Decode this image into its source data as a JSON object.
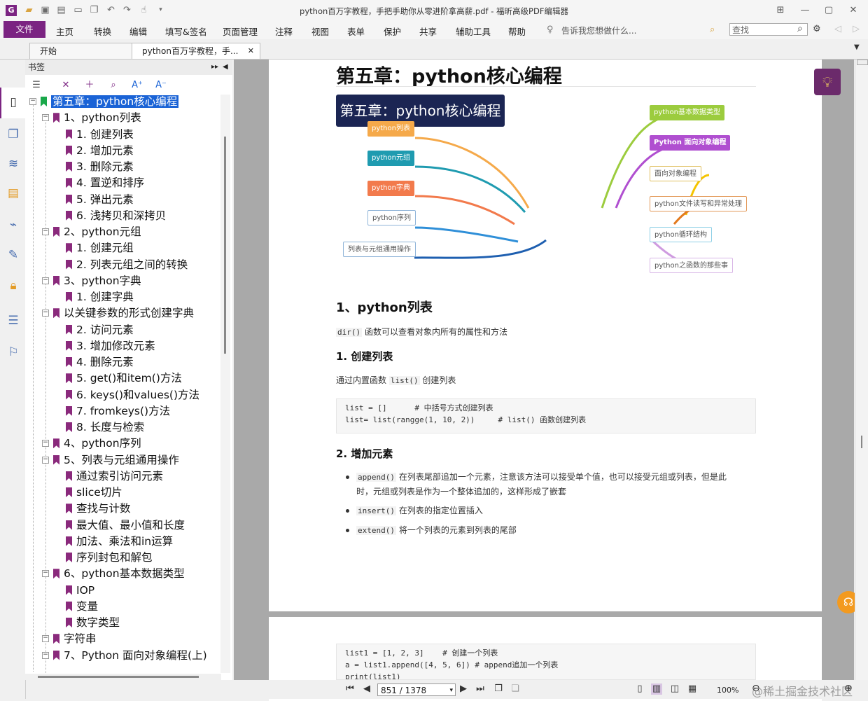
{
  "window": {
    "title": "python百万字教程，手把手助你从零进阶拿高薪.pdf - 福昕高级PDF编辑器"
  },
  "menu": {
    "file": "文件",
    "items": [
      "主页",
      "转换",
      "编辑",
      "填写&签名",
      "页面管理",
      "注释",
      "视图",
      "表单",
      "保护",
      "共享",
      "辅助工具",
      "帮助"
    ],
    "tell_me": "告诉我您想做什么...",
    "search_placeholder": "查找"
  },
  "tabs": [
    {
      "label": "开始"
    },
    {
      "label": "python百万字教程，手..."
    }
  ],
  "bookmarks": {
    "header": "书签",
    "items": [
      {
        "label": "第五章：python核心编程",
        "level": 0,
        "selected": true
      },
      {
        "label": "1、python列表",
        "level": 1
      },
      {
        "label": "1. 创建列表",
        "level": 2
      },
      {
        "label": "2. 增加元素",
        "level": 2
      },
      {
        "label": "3. 删除元素",
        "level": 2
      },
      {
        "label": "4. 置逆和排序",
        "level": 2
      },
      {
        "label": "5. 弹出元素",
        "level": 2
      },
      {
        "label": "6. 浅拷贝和深拷贝",
        "level": 2
      },
      {
        "label": "2、python元组",
        "level": 1
      },
      {
        "label": "1. 创建元组",
        "level": 2
      },
      {
        "label": "2. 列表元组之间的转换",
        "level": 2
      },
      {
        "label": "3、python字典",
        "level": 1
      },
      {
        "label": "1. 创建字典",
        "level": 2
      },
      {
        "label": "以关键参数的形式创建字典",
        "level": 1
      },
      {
        "label": "2. 访问元素",
        "level": 2
      },
      {
        "label": "3. 增加修改元素",
        "level": 2
      },
      {
        "label": "4. 删除元素",
        "level": 2
      },
      {
        "label": "5. get()和item()方法",
        "level": 2
      },
      {
        "label": "6. keys()和values()方法",
        "level": 2
      },
      {
        "label": "7. fromkeys()方法",
        "level": 2
      },
      {
        "label": "8. 长度与检索",
        "level": 2
      },
      {
        "label": "4、python序列",
        "level": 1
      },
      {
        "label": "5、列表与元组通用操作",
        "level": 1
      },
      {
        "label": "通过索引访问元素",
        "level": 2
      },
      {
        "label": "slice切片",
        "level": 2
      },
      {
        "label": "查找与计数",
        "level": 2
      },
      {
        "label": "最大值、最小值和长度",
        "level": 2
      },
      {
        "label": "加法、乘法和in运算",
        "level": 2
      },
      {
        "label": "序列封包和解包",
        "level": 2
      },
      {
        "label": "6、python基本数据类型",
        "level": 1
      },
      {
        "label": "IOP",
        "level": 2
      },
      {
        "label": "变量",
        "level": 2
      },
      {
        "label": "数字类型",
        "level": 2
      },
      {
        "label": "字符串",
        "level": 1
      },
      {
        "label": "7、Python 面向对象编程(上)",
        "level": 1
      }
    ]
  },
  "page": {
    "chapter_title": "第五章：python核心编程",
    "mindmap": {
      "center": "第五章：python核心编程",
      "left": [
        "python列表",
        "python元组",
        "python字典",
        "python序列",
        "列表与元组通用操作"
      ],
      "right": [
        "python基本数据类型",
        "Python 面向对象编程",
        "面向对象编程",
        "python文件读写和异常处理",
        "python循环结构",
        "python之函数的那些事"
      ],
      "colors": {
        "python列表": "#f5a94a",
        "python元组": "#1f9bb0",
        "python字典": "#f27a4c",
        "python序列": "#ffffff",
        "列表与元组通用操作": "#ffffff",
        "python基本数据类型": "#9ccc3e",
        "Python 面向对象编程": "#b04fd0",
        "面向对象编程": "#ffffff",
        "python文件读写和异常处理": "#ffffff",
        "python循环结构": "#ffffff",
        "python之函数的那些事": "#ffffff"
      }
    },
    "section1_title": "1、python列表",
    "dir_code": "dir()",
    "dir_text": "函数可以查看对象内所有的属性和方法",
    "sub1_title": "1. 创建列表",
    "sub1_text_a": "通过内置函数",
    "sub1_code": "list()",
    "sub1_text_b": "创建列表",
    "code1": "list = []      # 中括号方式创建列表\nlist= list(rangge(1, 10, 2))     # list() 函数创建列表",
    "sub2_title": "2. 增加元素",
    "bullets": [
      {
        "code": "append()",
        "text": "在列表尾部追加一个元素，注意该方法可以接受单个值，也可以接受元组或列表，但是此",
        "text2": "时，元组或列表是作为一个整体追加的，这样形成了嵌套"
      },
      {
        "code": "insert()",
        "text": "在列表的指定位置插入",
        "text2": ""
      },
      {
        "code": "extend()",
        "text": "将一个列表的元素到列表的尾部",
        "text2": ""
      }
    ],
    "code2": "list1 = [1, 2, 3]    # 创建一个列表\na = list1.append([4, 5, 6]) # append追加一个列表\nprint(list1)"
  },
  "status": {
    "page_indicator": "851 / 1378",
    "zoom": "100%",
    "watermark": "@稀土掘金技术社区"
  },
  "colors": {
    "accent": "#7b2482",
    "selection": "#1a63d6",
    "bookmark_flag": "#8a2a7c",
    "chapter_flag": "#19a84a"
  }
}
